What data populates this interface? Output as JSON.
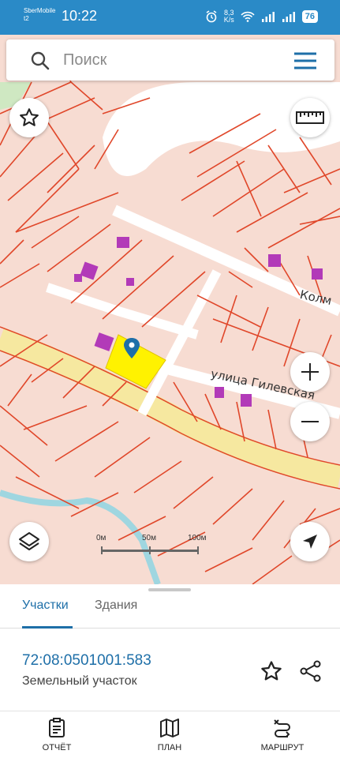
{
  "status_bar": {
    "carrier_line1": "SberMobile",
    "carrier_line2": "t2",
    "time": "10:22",
    "net_speed_value": "8,3",
    "net_speed_unit": "K/s",
    "battery": "76"
  },
  "search": {
    "placeholder": "Поиск"
  },
  "map": {
    "street_labels": [
      "Колм",
      "улица Гилевская"
    ],
    "scale": {
      "labels": [
        "0м",
        "50м",
        "100м"
      ]
    },
    "colors": {
      "parcel_fill": "#f7dcd2",
      "parcel_border": "#e0472a",
      "selected_parcel": "#fff200",
      "building": "#b23ab8",
      "road": "#f6e8a0",
      "river": "#9fd6e0",
      "pin": "#1e6fa8"
    }
  },
  "tabs": [
    {
      "label": "Участки",
      "active": true
    },
    {
      "label": "Здания",
      "active": false
    }
  ],
  "parcel": {
    "cadastral_number": "72:08:0501001:583",
    "type": "Земельный участок"
  },
  "bottom_nav": [
    {
      "label": "ОТЧЁТ",
      "icon": "report-icon"
    },
    {
      "label": "ПЛАН",
      "icon": "map-plan-icon"
    },
    {
      "label": "МАРШРУТ",
      "icon": "route-icon"
    }
  ],
  "colors": {
    "accent": "#1e6fa8",
    "status_bar": "#2a8ac7"
  }
}
